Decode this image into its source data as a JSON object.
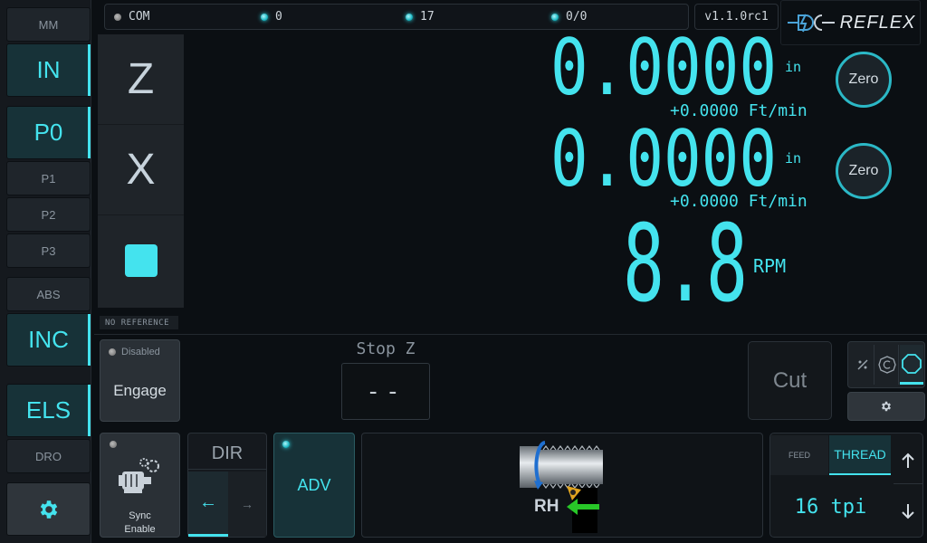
{
  "sidebar": {
    "units_label": "MM",
    "units_active": "IN",
    "positions": [
      "P0",
      "P1",
      "P2",
      "P3"
    ],
    "mode_label": "ABS",
    "mode_active": "INC",
    "els": "ELS",
    "dro": "DRO",
    "settings_icon": "gear-icon"
  },
  "status": {
    "com": "COM",
    "item1": "0",
    "item2": "17",
    "item3": "0/0",
    "version": "v1.1.0rc1",
    "logo": "REFLEX"
  },
  "axes": {
    "z_label": "Z",
    "x_label": "X",
    "z_value": "0.0000",
    "z_unit": "in",
    "z_feed": "+0.0000 Ft/min",
    "x_value": "0.0000",
    "x_unit": "in",
    "x_feed": "+0.0000 Ft/min",
    "zero_label": "Zero",
    "rpm_label": "RPM",
    "rpm_value": "8.8"
  },
  "reference": "NO REFERENCE",
  "engage": {
    "status": "Disabled",
    "label": "Engage"
  },
  "stop": {
    "title": "Stop Z",
    "value": "--"
  },
  "cut": "Cut",
  "sync": {
    "line1": "Sync",
    "line2": "Enable"
  },
  "dir": {
    "title": "DIR",
    "left": "←",
    "right": "→"
  },
  "adv": "ADV",
  "lathe": {
    "hand": "RH"
  },
  "thread": {
    "tab_feed": "FEED",
    "tab_thread": "THREAD",
    "value": "16 tpi"
  },
  "colors": {
    "accent": "#44e3ee",
    "background": "#0b0f13"
  }
}
